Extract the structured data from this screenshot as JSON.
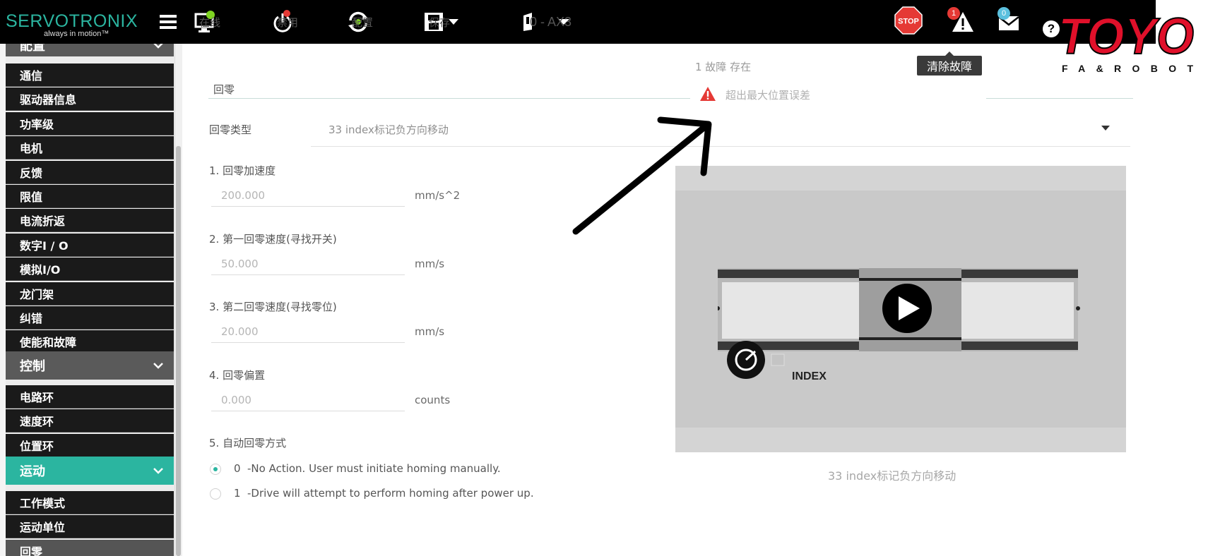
{
  "app": {
    "brand": "SERVOTRONIX",
    "tagline": "always in motion™",
    "toolbar": {
      "online_label": "在线",
      "disable_label": "禁用",
      "config_label": "配置",
      "save_label": "保存",
      "axis_label": "0 - AX3",
      "stop_label": "STOP",
      "fault_badge": "1",
      "msg_badge": "0",
      "help_label": "?"
    },
    "tooltip": "清除故障"
  },
  "sidebar": {
    "top_partial_label": "配置",
    "config_items": [
      "通信",
      "驱动器信息",
      "功率级",
      "电机",
      "反馈",
      "限值",
      "电流折返",
      "数字I / O",
      "模拟I/O",
      "龙门架",
      "纠错",
      "使能和故障"
    ],
    "control_header": "控制",
    "control_items": [
      "电路环",
      "速度环",
      "位置环"
    ],
    "motion_header": "运动",
    "motion_items": [
      "工作模式",
      "运动单位",
      "回零"
    ]
  },
  "fault": {
    "count_text": "1 故障 存在",
    "message": "超出最大位置误差"
  },
  "homing": {
    "section_title": "回零",
    "type_label": "回零类型",
    "type_value": "33 index标记负方向移动",
    "fields": [
      {
        "label": "1. 回零加速度",
        "value": "200.000",
        "unit": "mm/s^2"
      },
      {
        "label": "2. 第一回零速度(寻找开关)",
        "value": "50.000",
        "unit": "mm/s"
      },
      {
        "label": "3. 第二回零速度(寻找零位)",
        "value": "20.000",
        "unit": "mm/s"
      },
      {
        "label": "4. 回零偏置",
        "value": "0.000",
        "unit": "counts"
      }
    ],
    "auto_label": "5. 自动回零方式",
    "auto_options": [
      {
        "value": "0",
        "text": "-No Action. User must initiate homing manually.",
        "selected": true
      },
      {
        "value": "1",
        "text": "-Drive will attempt to perform homing after power up.",
        "selected": false
      }
    ],
    "video_index_label": "INDEX",
    "video_caption": "33 index标记负方向移动"
  },
  "overlay": {
    "logo_main": "TOYO",
    "logo_sub": "FA&ROBOT"
  },
  "colors": {
    "accent": "#2bb5a0",
    "topbar": "#000000",
    "sidebar_item": "#1a1a1a",
    "sidebar_header": "#5a5a5a",
    "fault_red": "#e53935",
    "toyo_red": "#e0102a"
  }
}
